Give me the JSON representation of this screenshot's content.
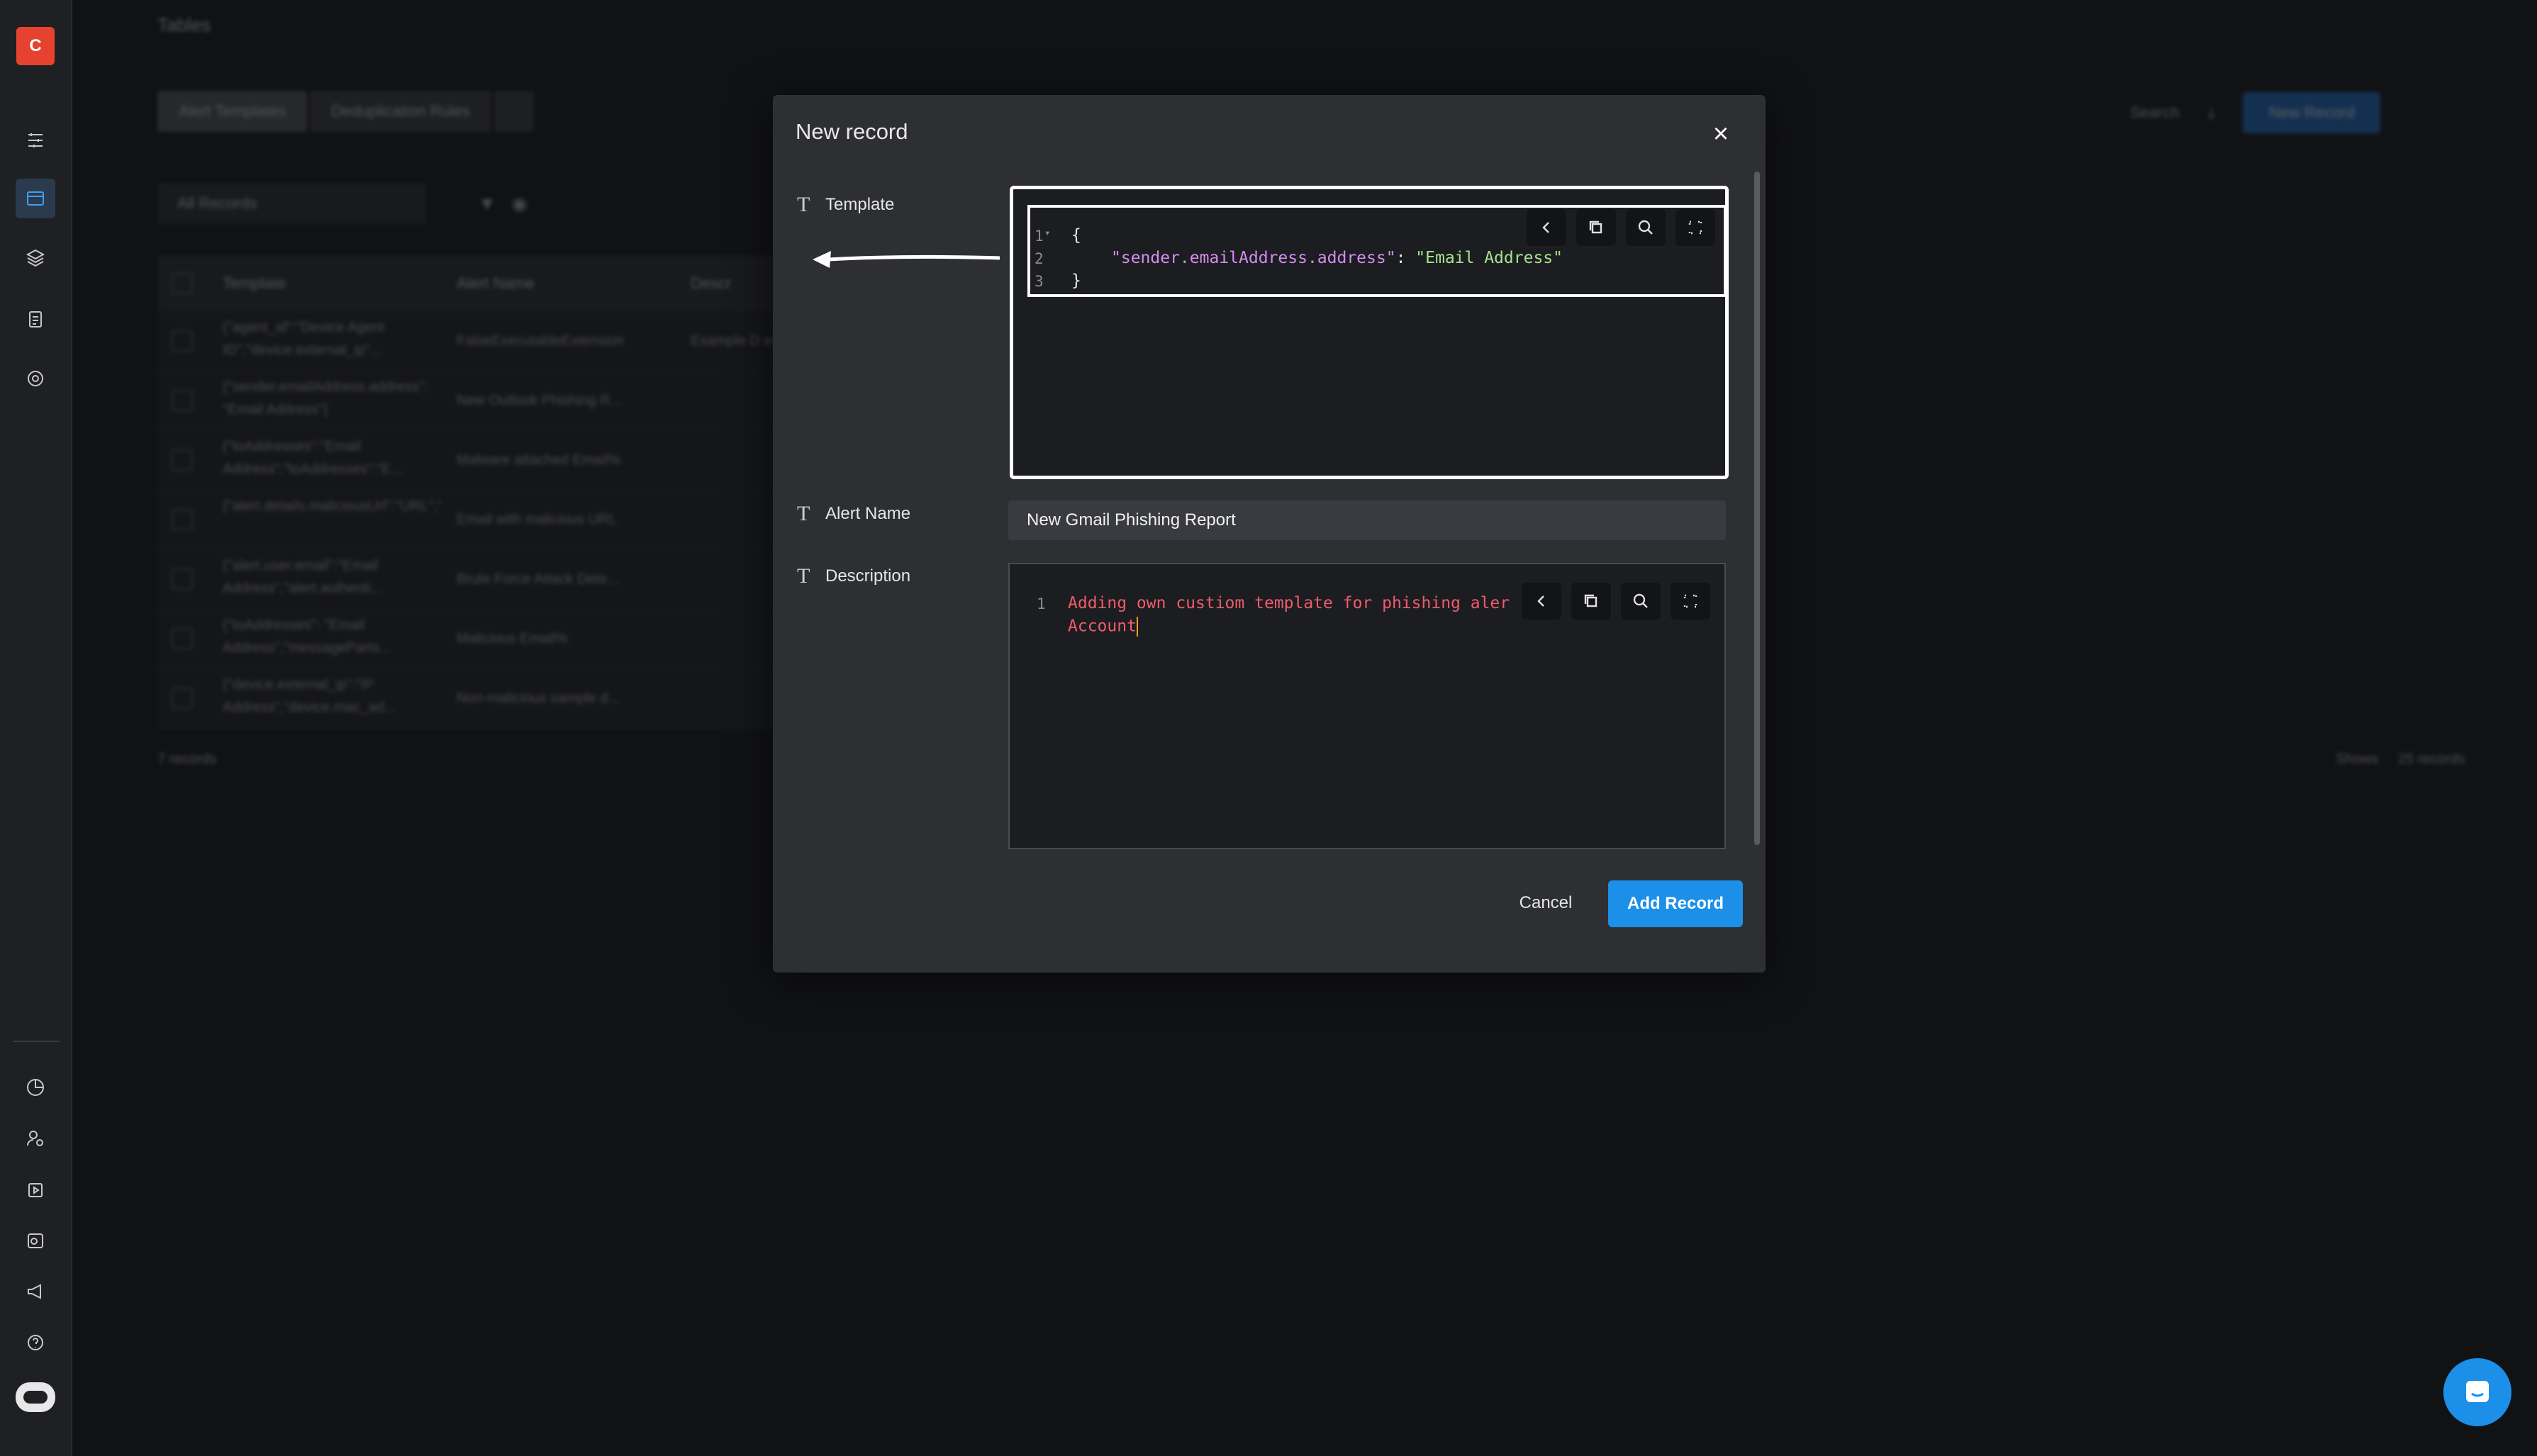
{
  "sidebar": {
    "logo": "C",
    "top_icons": [
      "pipeline-icon",
      "tables-icon",
      "layers-icon",
      "clipboard-icon",
      "target-icon"
    ],
    "bottom_icons": [
      "analytics-icon",
      "users-icon",
      "play-icon",
      "billing-icon",
      "megaphone-icon",
      "help-icon",
      "bot-icon"
    ]
  },
  "background": {
    "page_title": "Tables",
    "tabs": [
      "Alert Templates",
      "Deduplication Rules"
    ],
    "filter": "All Records",
    "search_placeholder": "Search",
    "new_record_label": "New Record",
    "columns": [
      "Template",
      "Alert Name",
      "Descr"
    ],
    "rows": [
      {
        "template": "{\"agent_id\":\"Device Agent ID\",\"device.external_ip\"...",
        "name": "FalseExecutableExtension",
        "desc": "Example D ext test tes"
      },
      {
        "template": "{\"sender.emailAddress.address\": \"Email Address\"}",
        "name": "New Outlook Phishing R...",
        "desc": ""
      },
      {
        "template": "{\"toAddresses\":\"Email Address\",\"toAddresses\":\"E...",
        "name": "Malware attached Email%",
        "desc": ""
      },
      {
        "template": "{\"alert.details.maliciousUrl\":\"URL\",\"alert.email.sen...",
        "name": "Email with malicious URL",
        "desc": ""
      },
      {
        "template": "{\"alert.user.email\":\"Email Address\",\"alert.authenti...",
        "name": "Brute Force Attack Dete...",
        "desc": ""
      },
      {
        "template": "{\"toAddresses\": \"Email Address\",\"messageParts...",
        "name": "Malicious Email%",
        "desc": ""
      },
      {
        "template": "{\"device.external_ip\":\"IP Address\",\"device.mac_ad...",
        "name": "Non-malicious sample d...",
        "desc": ""
      }
    ],
    "record_count": "7 records",
    "shows_label": "Shows",
    "page_size": "25 records"
  },
  "modal": {
    "title": "New record",
    "close_label": "×",
    "template_label": "Template",
    "template_lines": [
      {
        "n": "1",
        "open": "{"
      },
      {
        "n": "2",
        "key": "\"sender.emailAddress.address\"",
        "colon": ": ",
        "value": "\"Email Address\""
      },
      {
        "n": "3",
        "close": "}"
      }
    ],
    "alert_name_label": "Alert Name",
    "alert_name_value": "New Gmail Phishing Report",
    "description_label": "Description",
    "description_line_no": "1",
    "description_text_1a": "Adding own custiom template for phishing aler",
    "description_text_1b": "d C",
    "description_text_2": "Account",
    "editor_tools": [
      "chevron-left-icon",
      "copy-icon",
      "search-icon",
      "fullscreen-icon"
    ],
    "cancel_label": "Cancel",
    "add_label": "Add Record"
  },
  "colors": {
    "accent": "#1c8fe8",
    "logo": "#e5432f",
    "json_key": "#d58cf0",
    "json_string": "#a8e28a",
    "description_text": "#ef5c6b"
  }
}
